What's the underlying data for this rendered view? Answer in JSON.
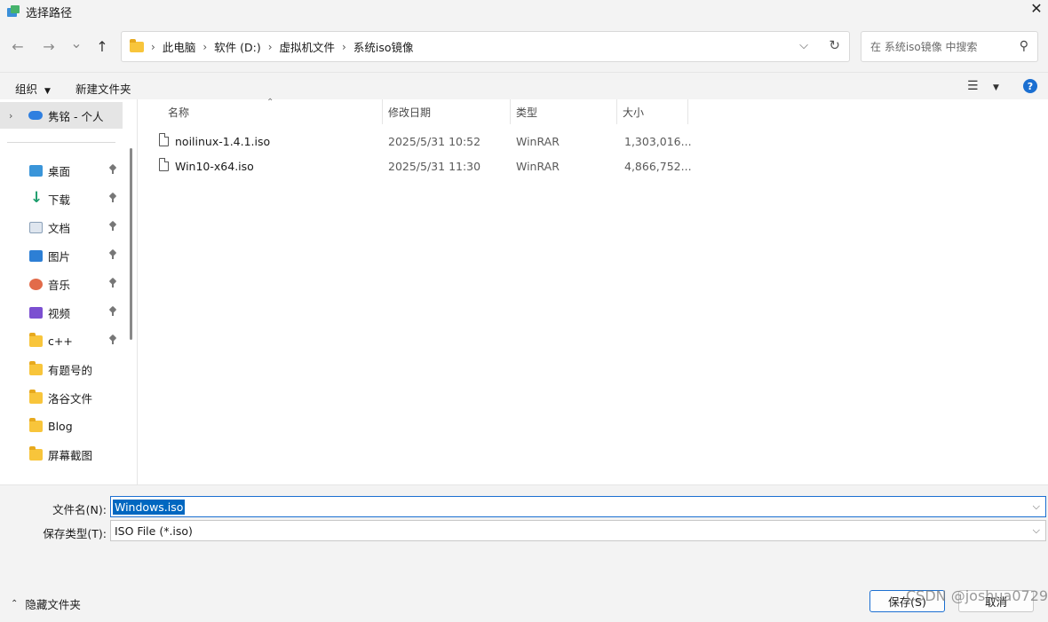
{
  "window": {
    "title": "选择路径",
    "close_glyph": "✕"
  },
  "nav": {
    "back_glyph": "←",
    "forward_glyph": "→",
    "recent_glyph": "⌄",
    "up_glyph": "↑",
    "breadcrumb": [
      "此电脑",
      "软件 (D:)",
      "虚拟机文件",
      "系统iso镜像"
    ],
    "search_placeholder": "在 系统iso镜像 中搜索"
  },
  "toolbar": {
    "organize": "组织",
    "new_folder": "新建文件夹",
    "help": "?"
  },
  "sidebar": {
    "cloud": {
      "label": "隽铭 - 个人"
    },
    "items": [
      {
        "label": "桌面",
        "icon": "desktop-icon",
        "pinned": true
      },
      {
        "label": "下载",
        "icon": "download-icon",
        "pinned": true
      },
      {
        "label": "文档",
        "icon": "document-icon",
        "pinned": true
      },
      {
        "label": "图片",
        "icon": "pictures-icon",
        "pinned": true
      },
      {
        "label": "音乐",
        "icon": "music-icon",
        "pinned": true
      },
      {
        "label": "视频",
        "icon": "video-icon",
        "pinned": true
      },
      {
        "label": "c++",
        "icon": "folder-icon",
        "pinned": true
      },
      {
        "label": "有题号的",
        "icon": "folder-icon",
        "pinned": false
      },
      {
        "label": "洛谷文件",
        "icon": "folder-icon",
        "pinned": false
      },
      {
        "label": "Blog",
        "icon": "folder-icon",
        "pinned": false
      },
      {
        "label": "屏幕截图",
        "icon": "folder-icon",
        "pinned": false
      }
    ]
  },
  "files": {
    "columns": [
      "名称",
      "修改日期",
      "类型",
      "大小"
    ],
    "rows": [
      {
        "name": "noilinux-1.4.1.iso",
        "date": "2025/5/31 10:52",
        "type": "WinRAR",
        "size": "1,303,016..."
      },
      {
        "name": "Win10-x64.iso",
        "date": "2025/5/31 11:30",
        "type": "WinRAR",
        "size": "4,866,752..."
      }
    ]
  },
  "bottom": {
    "filename_label": "文件名(N):",
    "filename_value": "Windows.iso",
    "filetype_label": "保存类型(T):",
    "filetype_value": "ISO File (*.iso)",
    "hide_folders": "隐藏文件夹",
    "save": "保存(S)",
    "cancel": "取消"
  },
  "watermark": "CSDN @joshua0729",
  "colors": {
    "accent": "#0067c0",
    "folder": "#f8c53b",
    "chrome": "#f3f3f3"
  }
}
